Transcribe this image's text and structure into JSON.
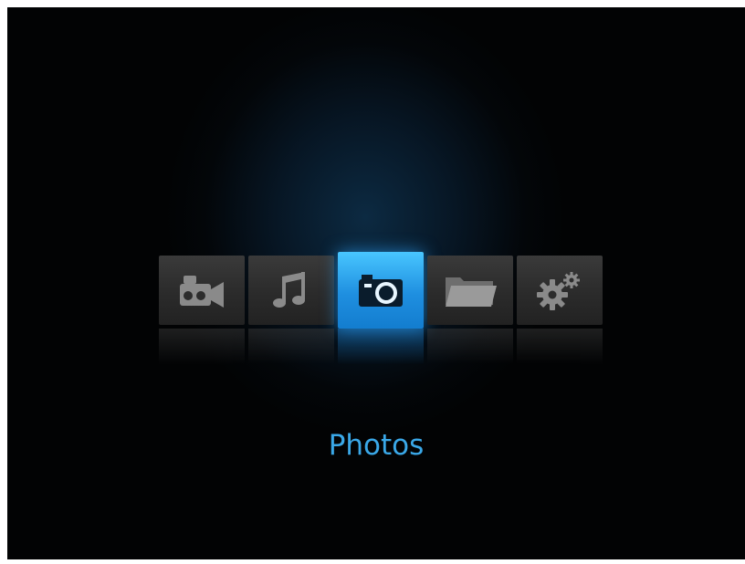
{
  "menu": {
    "items": [
      {
        "name": "videos",
        "icon": "video-camera-icon",
        "selected": false
      },
      {
        "name": "music",
        "icon": "music-note-icon",
        "selected": false
      },
      {
        "name": "photos",
        "icon": "camera-icon",
        "selected": true
      },
      {
        "name": "files",
        "icon": "folder-icon",
        "selected": false
      },
      {
        "name": "settings",
        "icon": "gears-icon",
        "selected": false
      }
    ],
    "selected_label": "Photos"
  },
  "colors": {
    "background": "#030609",
    "tile": "#2e2e2e",
    "selected_tile": "#2aa3f0",
    "label": "#3aa8e8",
    "icon": "#8a8a8a"
  }
}
